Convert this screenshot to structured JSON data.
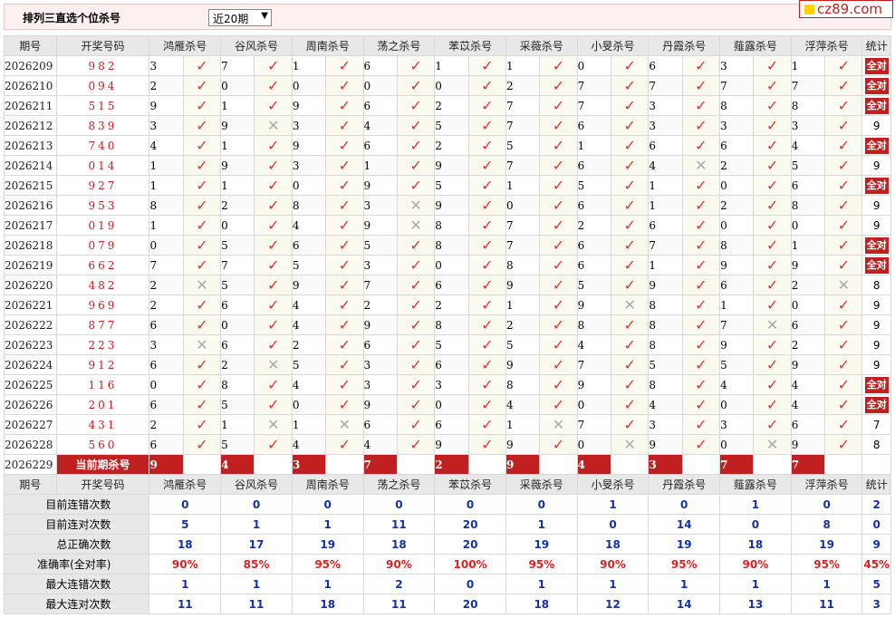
{
  "header": {
    "title": "排列三直选个位杀号",
    "period_select": "近20期",
    "logo_text": "cz89.com"
  },
  "columns": {
    "period": "期号",
    "draw": "开奖号码",
    "experts": [
      "鸿雁杀号",
      "谷风杀号",
      "周南杀号",
      "荡之杀号",
      "苯苡杀号",
      "采薇杀号",
      "小旻杀号",
      "丹霞杀号",
      "薤露杀号",
      "浮萍杀号"
    ],
    "stat": "统计"
  },
  "all_correct_label": "全对",
  "rows": [
    {
      "period": "2026209",
      "draw": "982",
      "kills": [
        3,
        7,
        1,
        6,
        1,
        1,
        0,
        6,
        3,
        1
      ],
      "ok": [
        1,
        1,
        1,
        1,
        1,
        1,
        1,
        1,
        1,
        1
      ],
      "stat": "全对"
    },
    {
      "period": "2026210",
      "draw": "094",
      "kills": [
        2,
        0,
        0,
        0,
        0,
        2,
        7,
        7,
        7,
        7
      ],
      "ok": [
        1,
        1,
        1,
        1,
        1,
        1,
        1,
        1,
        1,
        1
      ],
      "stat": "全对"
    },
    {
      "period": "2026211",
      "draw": "515",
      "kills": [
        9,
        1,
        9,
        6,
        2,
        7,
        7,
        3,
        8,
        8
      ],
      "ok": [
        1,
        1,
        1,
        1,
        1,
        1,
        1,
        1,
        1,
        1
      ],
      "stat": "全对"
    },
    {
      "period": "2026212",
      "draw": "839",
      "kills": [
        3,
        9,
        3,
        4,
        5,
        7,
        6,
        3,
        3,
        3
      ],
      "ok": [
        1,
        0,
        1,
        1,
        1,
        1,
        1,
        1,
        1,
        1
      ],
      "stat": "9"
    },
    {
      "period": "2026213",
      "draw": "740",
      "kills": [
        4,
        1,
        9,
        6,
        2,
        5,
        1,
        6,
        6,
        4
      ],
      "ok": [
        1,
        1,
        1,
        1,
        1,
        1,
        1,
        1,
        1,
        1
      ],
      "stat": "全对"
    },
    {
      "period": "2026214",
      "draw": "014",
      "kills": [
        1,
        9,
        3,
        1,
        9,
        7,
        6,
        4,
        2,
        5
      ],
      "ok": [
        1,
        1,
        1,
        1,
        1,
        1,
        1,
        0,
        1,
        1
      ],
      "stat": "9"
    },
    {
      "period": "2026215",
      "draw": "927",
      "kills": [
        1,
        1,
        0,
        9,
        5,
        1,
        5,
        1,
        0,
        6
      ],
      "ok": [
        1,
        1,
        1,
        1,
        1,
        1,
        1,
        1,
        1,
        1
      ],
      "stat": "全对"
    },
    {
      "period": "2026216",
      "draw": "953",
      "kills": [
        8,
        2,
        8,
        3,
        9,
        0,
        6,
        1,
        2,
        8
      ],
      "ok": [
        1,
        1,
        1,
        0,
        1,
        1,
        1,
        1,
        1,
        1
      ],
      "stat": "9"
    },
    {
      "period": "2026217",
      "draw": "019",
      "kills": [
        1,
        0,
        4,
        9,
        8,
        7,
        2,
        6,
        0,
        0
      ],
      "ok": [
        1,
        1,
        1,
        0,
        1,
        1,
        1,
        1,
        1,
        1
      ],
      "stat": "9"
    },
    {
      "period": "2026218",
      "draw": "079",
      "kills": [
        0,
        5,
        6,
        5,
        8,
        7,
        6,
        7,
        8,
        1
      ],
      "ok": [
        1,
        1,
        1,
        1,
        1,
        1,
        1,
        1,
        1,
        1
      ],
      "stat": "全对"
    },
    {
      "period": "2026219",
      "draw": "662",
      "kills": [
        7,
        7,
        5,
        3,
        0,
        8,
        6,
        1,
        9,
        9
      ],
      "ok": [
        1,
        1,
        1,
        1,
        1,
        1,
        1,
        1,
        1,
        1
      ],
      "stat": "全对"
    },
    {
      "period": "2026220",
      "draw": "482",
      "kills": [
        2,
        5,
        9,
        7,
        6,
        9,
        5,
        9,
        6,
        2
      ],
      "ok": [
        0,
        1,
        1,
        1,
        1,
        1,
        1,
        1,
        1,
        0
      ],
      "stat": "8"
    },
    {
      "period": "2026221",
      "draw": "969",
      "kills": [
        2,
        6,
        4,
        2,
        2,
        1,
        9,
        8,
        1,
        0
      ],
      "ok": [
        1,
        1,
        1,
        1,
        1,
        1,
        0,
        1,
        1,
        1
      ],
      "stat": "9"
    },
    {
      "period": "2026222",
      "draw": "877",
      "kills": [
        6,
        0,
        4,
        9,
        8,
        2,
        8,
        8,
        7,
        6
      ],
      "ok": [
        1,
        1,
        1,
        1,
        1,
        1,
        1,
        1,
        0,
        1
      ],
      "stat": "9"
    },
    {
      "period": "2026223",
      "draw": "223",
      "kills": [
        3,
        6,
        2,
        6,
        5,
        5,
        4,
        8,
        9,
        2
      ],
      "ok": [
        0,
        1,
        1,
        1,
        1,
        1,
        1,
        1,
        1,
        1
      ],
      "stat": "9"
    },
    {
      "period": "2026224",
      "draw": "912",
      "kills": [
        6,
        2,
        5,
        3,
        6,
        9,
        7,
        5,
        5,
        9
      ],
      "ok": [
        1,
        0,
        1,
        1,
        1,
        1,
        1,
        1,
        1,
        1
      ],
      "stat": "9"
    },
    {
      "period": "2026225",
      "draw": "116",
      "kills": [
        0,
        8,
        4,
        3,
        3,
        8,
        9,
        8,
        4,
        4
      ],
      "ok": [
        1,
        1,
        1,
        1,
        1,
        1,
        1,
        1,
        1,
        1
      ],
      "stat": "全对"
    },
    {
      "period": "2026226",
      "draw": "201",
      "kills": [
        6,
        5,
        0,
        9,
        0,
        4,
        0,
        4,
        0,
        4
      ],
      "ok": [
        1,
        1,
        1,
        1,
        1,
        1,
        1,
        1,
        1,
        1
      ],
      "stat": "全对"
    },
    {
      "period": "2026227",
      "draw": "431",
      "kills": [
        2,
        1,
        1,
        6,
        6,
        1,
        7,
        3,
        3,
        6
      ],
      "ok": [
        1,
        0,
        0,
        1,
        1,
        0,
        1,
        1,
        1,
        1
      ],
      "stat": "7"
    },
    {
      "period": "2026228",
      "draw": "560",
      "kills": [
        6,
        5,
        4,
        4,
        9,
        9,
        0,
        9,
        0,
        9
      ],
      "ok": [
        1,
        1,
        1,
        1,
        1,
        1,
        0,
        1,
        0,
        1
      ],
      "stat": "8"
    }
  ],
  "current": {
    "period": "2026229",
    "label": "当前期杀号",
    "kills": [
      "9",
      "4",
      "3",
      "7",
      "2",
      "9",
      "4",
      "3",
      "7",
      "7"
    ]
  },
  "summary": [
    {
      "label": "目前连错次数",
      "values": [
        "0",
        "0",
        "0",
        "0",
        "0",
        "0",
        "1",
        "0",
        "1",
        "0",
        "2"
      ]
    },
    {
      "label": "目前连对次数",
      "values": [
        "5",
        "1",
        "1",
        "11",
        "20",
        "1",
        "0",
        "14",
        "0",
        "8",
        "0"
      ]
    },
    {
      "label": "总正确次数",
      "values": [
        "18",
        "17",
        "19",
        "18",
        "20",
        "19",
        "18",
        "19",
        "18",
        "19",
        "9"
      ]
    },
    {
      "label": "准确率(全对率)",
      "values": [
        "90%",
        "85%",
        "95%",
        "90%",
        "100%",
        "95%",
        "90%",
        "95%",
        "90%",
        "95%",
        "45%"
      ]
    },
    {
      "label": "最大连错次数",
      "values": [
        "1",
        "1",
        "1",
        "2",
        "0",
        "1",
        "1",
        "1",
        "1",
        "1",
        "5"
      ]
    },
    {
      "label": "最大连对次数",
      "values": [
        "11",
        "11",
        "18",
        "11",
        "20",
        "18",
        "12",
        "14",
        "13",
        "11",
        "3"
      ]
    }
  ]
}
